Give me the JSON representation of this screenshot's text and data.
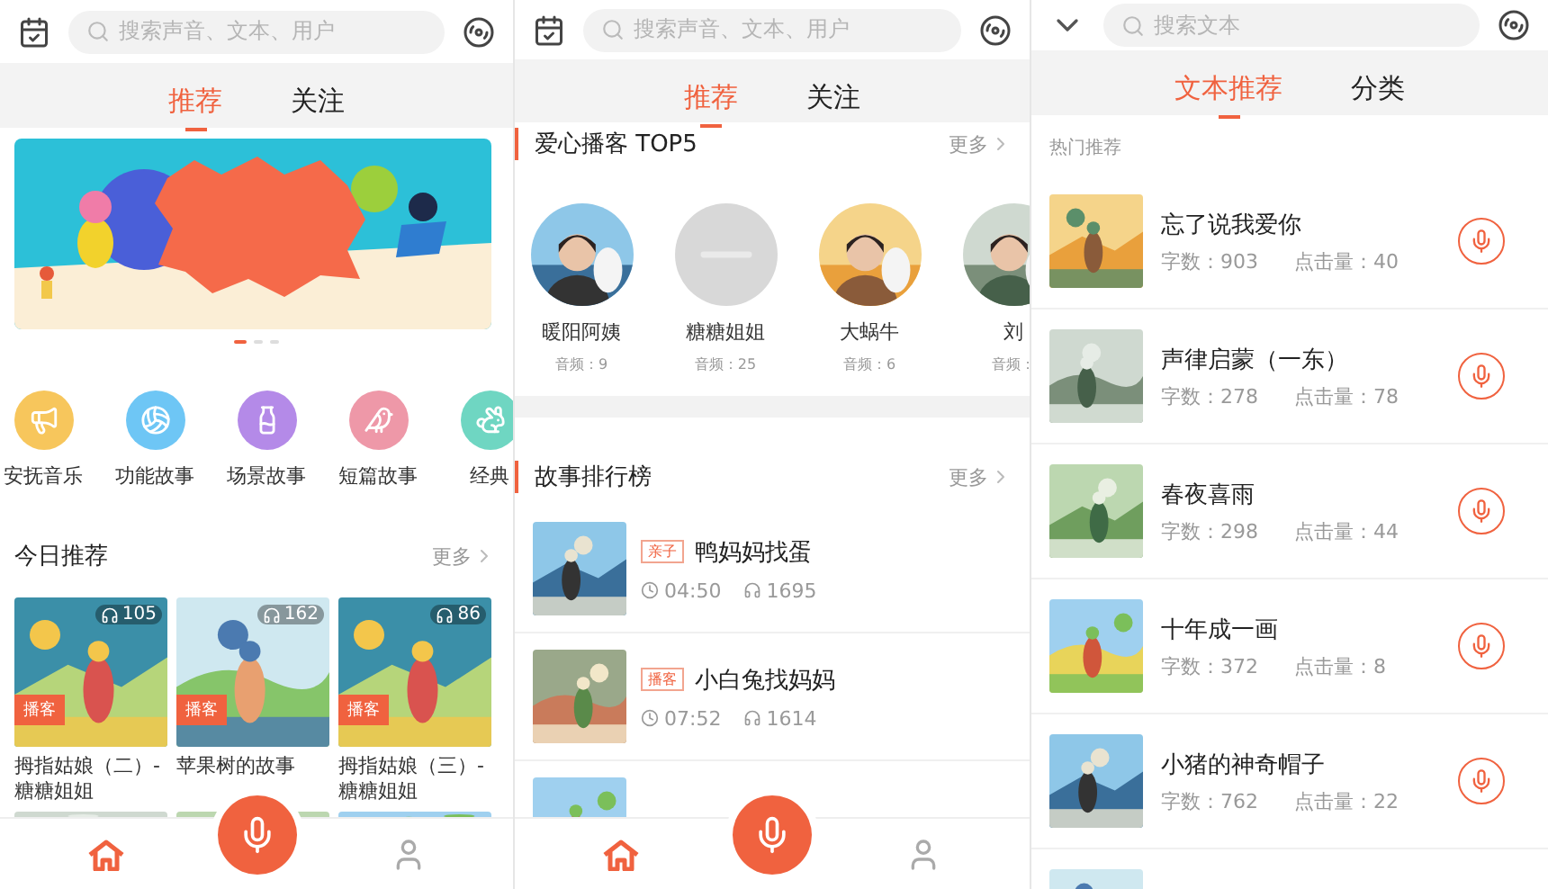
{
  "home": {
    "search": {
      "placeholder": "搜索声音、文本、用户"
    },
    "tabs": [
      {
        "label": "推荐",
        "selected": true
      },
      {
        "label": "关注",
        "selected": false
      }
    ],
    "carousel_dots": [
      {
        "selected": true
      },
      {
        "selected": false
      },
      {
        "selected": false
      }
    ],
    "categories": [
      {
        "label": "安抚音乐",
        "color": "#f7c65c"
      },
      {
        "label": "功能故事",
        "color": "#6ec6f5"
      },
      {
        "label": "场景故事",
        "color": "#b48ae8"
      },
      {
        "label": "短篇故事",
        "color": "#ee98a8"
      },
      {
        "label": "经典",
        "color": "#6fd6c2"
      }
    ],
    "today": {
      "title": "今日推荐",
      "more": "更多",
      "cards": [
        {
          "plays": "105",
          "badge": "播客",
          "title": "拇指姑娘（二）-糖糖姐姐"
        },
        {
          "plays": "162",
          "badge": "播客",
          "title": "苹果树的故事"
        },
        {
          "plays": "86",
          "badge": "播客",
          "title": "拇指姑娘（三）-糖糖姐姐"
        }
      ]
    },
    "nav": [
      {
        "kind": "home",
        "selected": true
      },
      {
        "kind": "record"
      },
      {
        "kind": "profile",
        "selected": false
      }
    ]
  },
  "following": {
    "search": {
      "placeholder": "搜索声音、文本、用户"
    },
    "tabs": [
      {
        "label": "推荐",
        "selected": true
      },
      {
        "label": "关注",
        "selected": false
      }
    ],
    "top5": {
      "title": "爱心播客 TOP5",
      "more": "更多",
      "podcasters": [
        {
          "name": "暖阳阿姨",
          "count": "音频：9"
        },
        {
          "name": "糖糖姐姐",
          "count": "音频：25"
        },
        {
          "name": "大蜗牛",
          "count": "音频：6"
        },
        {
          "name": "刘",
          "count": "音频："
        }
      ]
    },
    "ranking": {
      "title": "故事排行榜",
      "more": "更多",
      "stories": [
        {
          "tag": "亲子",
          "title": "鸭妈妈找蛋",
          "duration": "04:50",
          "plays": "1695"
        },
        {
          "tag": "播客",
          "title": "小白兔找妈妈",
          "duration": "07:52",
          "plays": "1614"
        }
      ]
    },
    "nav": [
      {
        "kind": "home",
        "selected": true
      },
      {
        "kind": "record"
      },
      {
        "kind": "profile",
        "selected": false
      }
    ]
  },
  "texts": {
    "search": {
      "placeholder": "搜索文本"
    },
    "tabs": [
      {
        "label": "文本推荐",
        "selected": true
      },
      {
        "label": "分类",
        "selected": false
      }
    ],
    "section": "热门推荐",
    "items": [
      {
        "title": "忘了说我爱你",
        "words": "字数：903",
        "clicks": "点击量：40"
      },
      {
        "title": "声律启蒙（一东）",
        "words": "字数：278",
        "clicks": "点击量：78"
      },
      {
        "title": "春夜喜雨",
        "words": "字数：298",
        "clicks": "点击量：44"
      },
      {
        "title": "十年成一画",
        "words": "字数：372",
        "clicks": "点击量：8"
      },
      {
        "title": "小猪的神奇帽子",
        "words": "字数：762",
        "clicks": "点击量：22"
      }
    ]
  }
}
